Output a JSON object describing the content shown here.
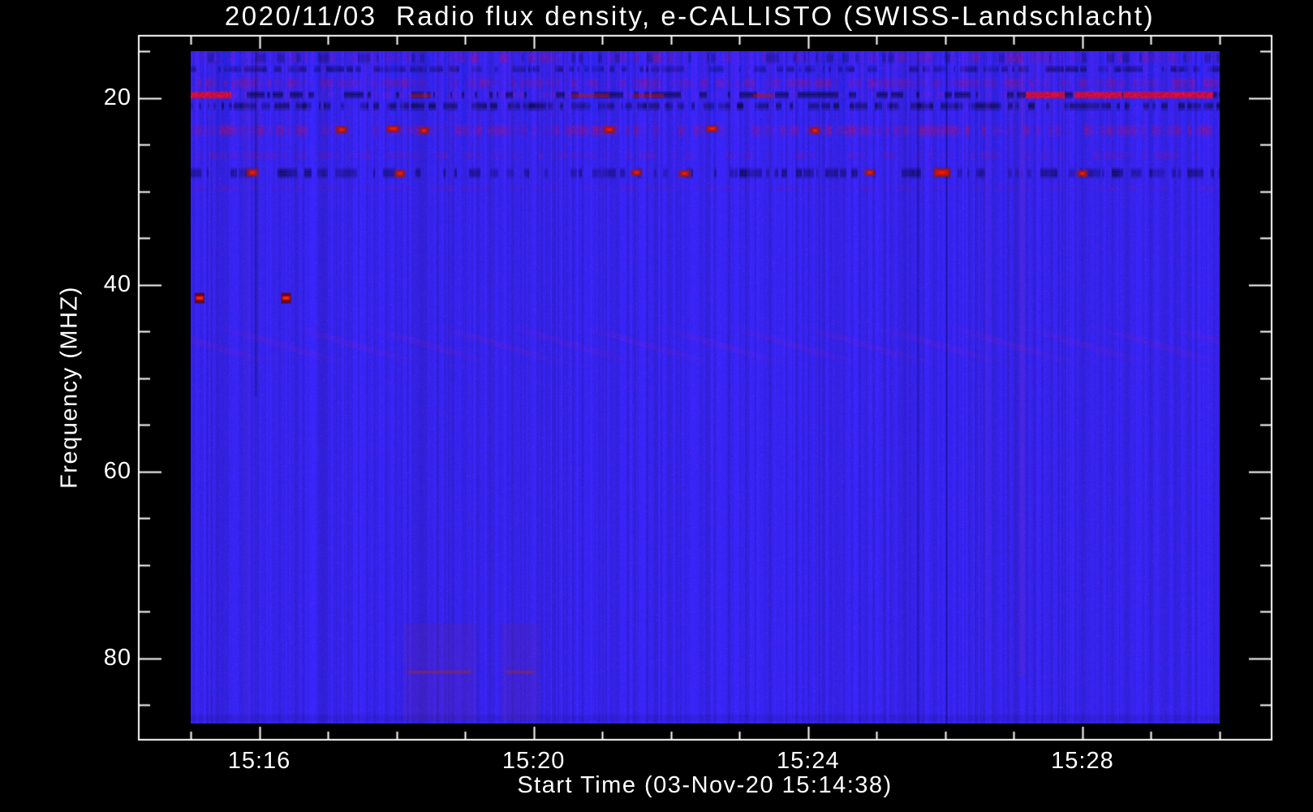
{
  "title": "2020/11/03  Radio flux density, e-CALLISTO (SWISS-Landschlacht)",
  "chart_data": {
    "type": "heatmap",
    "title": "2020/11/03  Radio flux density, e-CALLISTO (SWISS-Landschlacht)",
    "xlabel": "Start Time (03-Nov-20 15:14:38)",
    "ylabel": "Frequency (MHZ)",
    "x_tick_labels": [
      "15:16",
      "15:20",
      "15:24",
      "15:28"
    ],
    "x_tick_minutes_after_image_start": [
      1,
      5,
      9,
      13
    ],
    "x_minor_tick_every_min": 1,
    "x_image_span": {
      "start": "15:15:00",
      "end": "15:30:00"
    },
    "y_tick_labels": [
      "20",
      "40",
      "60",
      "80"
    ],
    "y_tick_values_mhz": [
      20,
      40,
      60,
      80
    ],
    "y_minor_step_mhz": 5,
    "y_image_span_mhz": [
      15,
      87
    ],
    "grid": false,
    "legend": "none",
    "colors": {
      "background": "#000000",
      "axis": "#FFFFFF",
      "text": "#FFFFFF",
      "base_blue": "#2823EB",
      "red_bright": "#E01505",
      "red_dark": "#8C1A28",
      "dark_navy": "#05053C",
      "purple": "#6A30C0",
      "magenta_low": "#7A2A6A"
    },
    "bands": [
      {
        "f": [
          15.0,
          16.45
        ],
        "type": "mottle-mix",
        "intensity": 0.55
      },
      {
        "f": [
          16.5,
          17.35
        ],
        "type": "dark-dash",
        "intensity": 0.75
      },
      {
        "f": [
          17.75,
          19.15
        ],
        "type": "red-mottle",
        "intensity": 0.5
      },
      {
        "f": [
          19.25,
          20.15
        ],
        "type": "red-line",
        "intensity": 0.95,
        "bright_segments_min": [
          [
            0.0,
            0.6
          ],
          [
            12.18,
            12.74
          ],
          [
            12.89,
            13.57
          ],
          [
            13.6,
            14.9
          ]
        ],
        "medium_segments_min": [
          [
            3.2,
            3.5
          ],
          [
            5.55,
            6.1
          ],
          [
            6.45,
            6.9
          ],
          [
            8.2,
            8.5
          ]
        ]
      },
      {
        "f": [
          20.3,
          21.45
        ],
        "type": "dark-dash",
        "intensity": 0.85
      },
      {
        "f": [
          22.7,
          24.3
        ],
        "type": "red-mottle",
        "intensity": 0.55
      },
      {
        "f": [
          25.6,
          26.75
        ],
        "type": "red-mottle",
        "intensity": 0.32
      },
      {
        "f": [
          27.4,
          28.75
        ],
        "type": "dark-dash",
        "intensity": 0.85
      },
      {
        "f": [
          29.2,
          30.2
        ],
        "type": "red-mottle",
        "intensity": 0.18
      },
      {
        "f": [
          44.3,
          48.6
        ],
        "type": "herringbone",
        "intensity": 0.5
      },
      {
        "f": [
          85.9,
          87.0
        ],
        "type": "dark-tint",
        "intensity": 0.5
      }
    ],
    "spots": [
      {
        "m": 2.2,
        "f": 23.4,
        "w": 8,
        "h": 5
      },
      {
        "m": 2.95,
        "f": 23.3,
        "w": 12,
        "h": 5
      },
      {
        "m": 3.4,
        "f": 23.5,
        "w": 7,
        "h": 5
      },
      {
        "m": 6.1,
        "f": 23.4,
        "w": 9,
        "h": 5
      },
      {
        "m": 7.6,
        "f": 23.3,
        "w": 10,
        "h": 5
      },
      {
        "m": 9.1,
        "f": 23.5,
        "w": 7,
        "h": 5
      },
      {
        "m": 0.9,
        "f": 28.0,
        "w": 9,
        "h": 6
      },
      {
        "m": 3.05,
        "f": 28.1,
        "w": 8,
        "h": 6
      },
      {
        "m": 6.5,
        "f": 28.0,
        "w": 8,
        "h": 5
      },
      {
        "m": 7.2,
        "f": 28.1,
        "w": 9,
        "h": 5
      },
      {
        "m": 9.9,
        "f": 28.0,
        "w": 7,
        "h": 5
      },
      {
        "m": 10.95,
        "f": 28.0,
        "w": 16,
        "h": 7
      },
      {
        "m": 13.0,
        "f": 28.1,
        "w": 8,
        "h": 5
      }
    ],
    "point_sources": [
      {
        "m": 0.13,
        "f": 41.4
      },
      {
        "m": 1.39,
        "f": 41.4
      }
    ],
    "vertical_streaks": [
      {
        "m": 0.82,
        "w": 7,
        "type": "purple",
        "a": 0.14,
        "f": [
          15,
          87
        ]
      },
      {
        "m": 0.95,
        "w": 2,
        "type": "dark",
        "a": 0.28,
        "f": [
          15,
          52
        ]
      },
      {
        "m": 10.6,
        "w": 3,
        "type": "dark",
        "a": 0.22,
        "f": [
          15,
          87
        ]
      },
      {
        "m": 11.02,
        "w": 2,
        "type": "dark",
        "a": 0.45,
        "f": [
          15,
          87
        ]
      },
      {
        "m": 11.62,
        "w": 3,
        "type": "red",
        "a": 0.1,
        "f": [
          17,
          78
        ]
      },
      {
        "m": 12.12,
        "w": 7,
        "type": "red",
        "a": 0.1,
        "f": [
          16,
          82
        ]
      }
    ],
    "low_band_segments": [
      {
        "m": [
          3.17,
          4.09
        ],
        "f": 81.5
      },
      {
        "m": [
          4.6,
          5.01
        ],
        "f": 81.5
      }
    ]
  }
}
